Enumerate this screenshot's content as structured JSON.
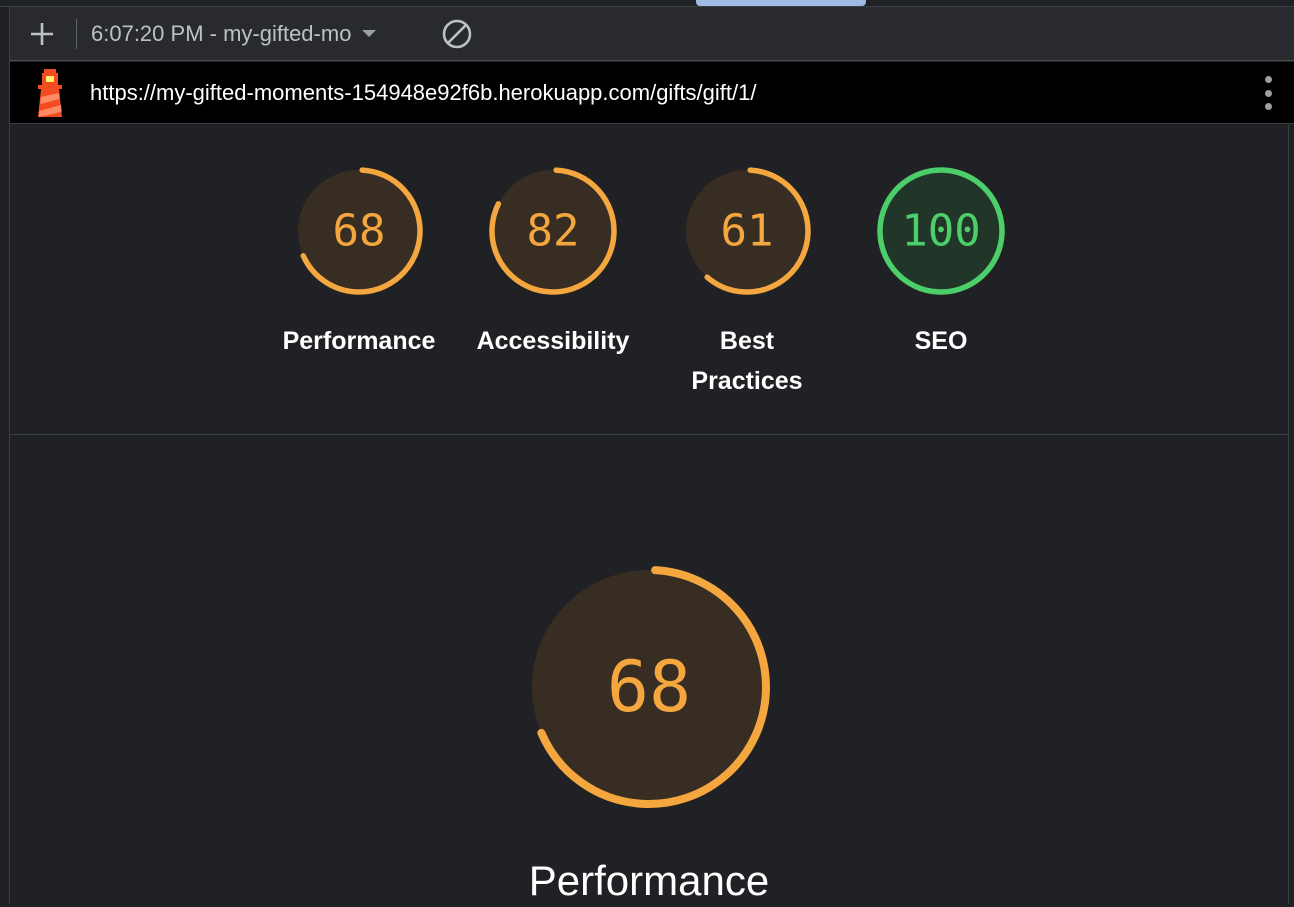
{
  "toolbar": {
    "plus_icon": "plus-icon",
    "report_select": "6:07:20 PM - my-gifted-mo",
    "caret_icon": "caret-down-icon",
    "clear_icon": "block-icon"
  },
  "urlbar": {
    "logo_icon": "lighthouse-icon",
    "url": "https://my-gifted-moments-154948e92f6b.herokuapp.com/gifts/gift/1/",
    "menu_icon": "more-vertical-icon"
  },
  "colors": {
    "average": "#f4a63f",
    "average_bg": "#382d22",
    "pass": "#4cce6a",
    "pass_bg": "#213528",
    "background": "#202124"
  },
  "scores": [
    {
      "id": "performance",
      "score": 68,
      "label": "Performance",
      "rating": "average"
    },
    {
      "id": "accessibility",
      "score": 82,
      "label": "Accessibility",
      "rating": "average"
    },
    {
      "id": "best-practices",
      "score": 61,
      "label": "Best Practices",
      "rating": "average"
    },
    {
      "id": "seo",
      "score": 100,
      "label": "SEO",
      "rating": "pass"
    }
  ],
  "detail": {
    "score": 68,
    "label": "Performance",
    "rating": "average"
  }
}
